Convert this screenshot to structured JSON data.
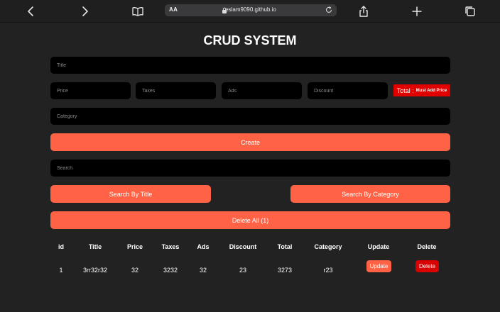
{
  "browser": {
    "text_size_label": "AA",
    "url": "eslam9090.github.io"
  },
  "page": {
    "title": "CRUD SYSTEM"
  },
  "form": {
    "title_placeholder": "Title",
    "price_placeholder": "Price",
    "taxes_placeholder": "Taxes",
    "ads_placeholder": "Ads",
    "discount_placeholder": "Discount",
    "total_label": "Total :",
    "total_message": "Must Add Price",
    "category_placeholder": "Category",
    "create_label": "Create",
    "search_placeholder": "Search",
    "search_by_title_label": "Search By Title",
    "search_by_category_label": "Search By Category",
    "delete_all_label": "Delete All (1)"
  },
  "table": {
    "headers": [
      "id",
      "Title",
      "Price",
      "Taxes",
      "Ads",
      "Discount",
      "Total",
      "Category",
      "Update",
      "Delete"
    ],
    "rows": [
      {
        "id": "1",
        "title": "3rr32r32",
        "price": "32",
        "taxes": "3232",
        "ads": "32",
        "discount": "23",
        "total": "3273",
        "category": "r23",
        "update_label": "Update",
        "delete_label": "Delete"
      }
    ]
  },
  "colors": {
    "accent": "#ff6245",
    "danger": "#d80000",
    "total_bg": "#e00000",
    "background": "#222222",
    "input_bg": "#000000"
  }
}
